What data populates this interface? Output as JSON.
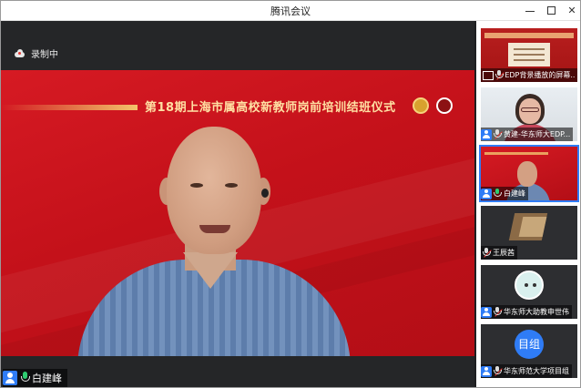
{
  "window": {
    "title": "腾讯会议"
  },
  "recording": {
    "label": "录制中"
  },
  "main_video": {
    "banner_title": "第18期上海市属高校新教师岗前培训结班仪式",
    "participant": {
      "name": "白建峰",
      "mic_active": true
    }
  },
  "sidebar": {
    "participants": [
      {
        "name": "EDP背景播放的屏幕...",
        "kind": "screen-share",
        "mic_active": false
      },
      {
        "name": "黄建-华东师大EDP...",
        "kind": "video",
        "mic_active": false
      },
      {
        "name": "白建峰",
        "kind": "video",
        "mic_active": true,
        "active": true
      },
      {
        "name": "王辰茜",
        "kind": "video",
        "mic_active": false
      },
      {
        "name": "华东师大助教申世伟",
        "kind": "avatar",
        "mic_active": false
      },
      {
        "name": "华东师范大学项目组",
        "kind": "text-avatar",
        "avatar_text": "目组",
        "mic_active": false
      }
    ]
  },
  "colors": {
    "accent": "#2f7cf6",
    "banner_red": "#c4111a",
    "mic_green": "#2ecc71"
  }
}
